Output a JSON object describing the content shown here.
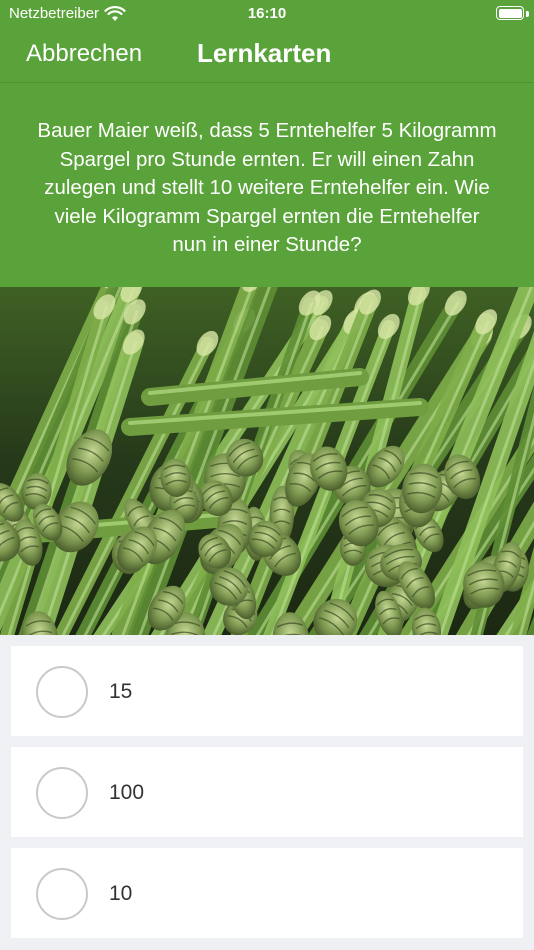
{
  "status_bar": {
    "carrier": "Netzbetreiber",
    "time": "16:10",
    "wifi_icon": "wifi-icon",
    "battery_icon": "battery-icon"
  },
  "nav": {
    "cancel_label": "Abbrechen",
    "title": "Lernkarten"
  },
  "question": {
    "text": "Bauer Maier weiß, dass 5 Erntehelfer 5 Kilogramm Spargel pro Stunde ernten. Er will einen Zahn zulegen und stellt 10 weitere Erntehelfer ein. Wie viele Kilogramm Spargel ernten die Erntehelfer nun in einer Stunde?"
  },
  "image": {
    "subject": "green asparagus"
  },
  "answers": [
    {
      "label": "15",
      "selected": false
    },
    {
      "label": "100",
      "selected": false
    },
    {
      "label": "10",
      "selected": false
    }
  ],
  "colors": {
    "header_green": "#5aa33a",
    "background": "#eef0f3",
    "card": "#ffffff",
    "radio_border": "#c9c9cc"
  }
}
